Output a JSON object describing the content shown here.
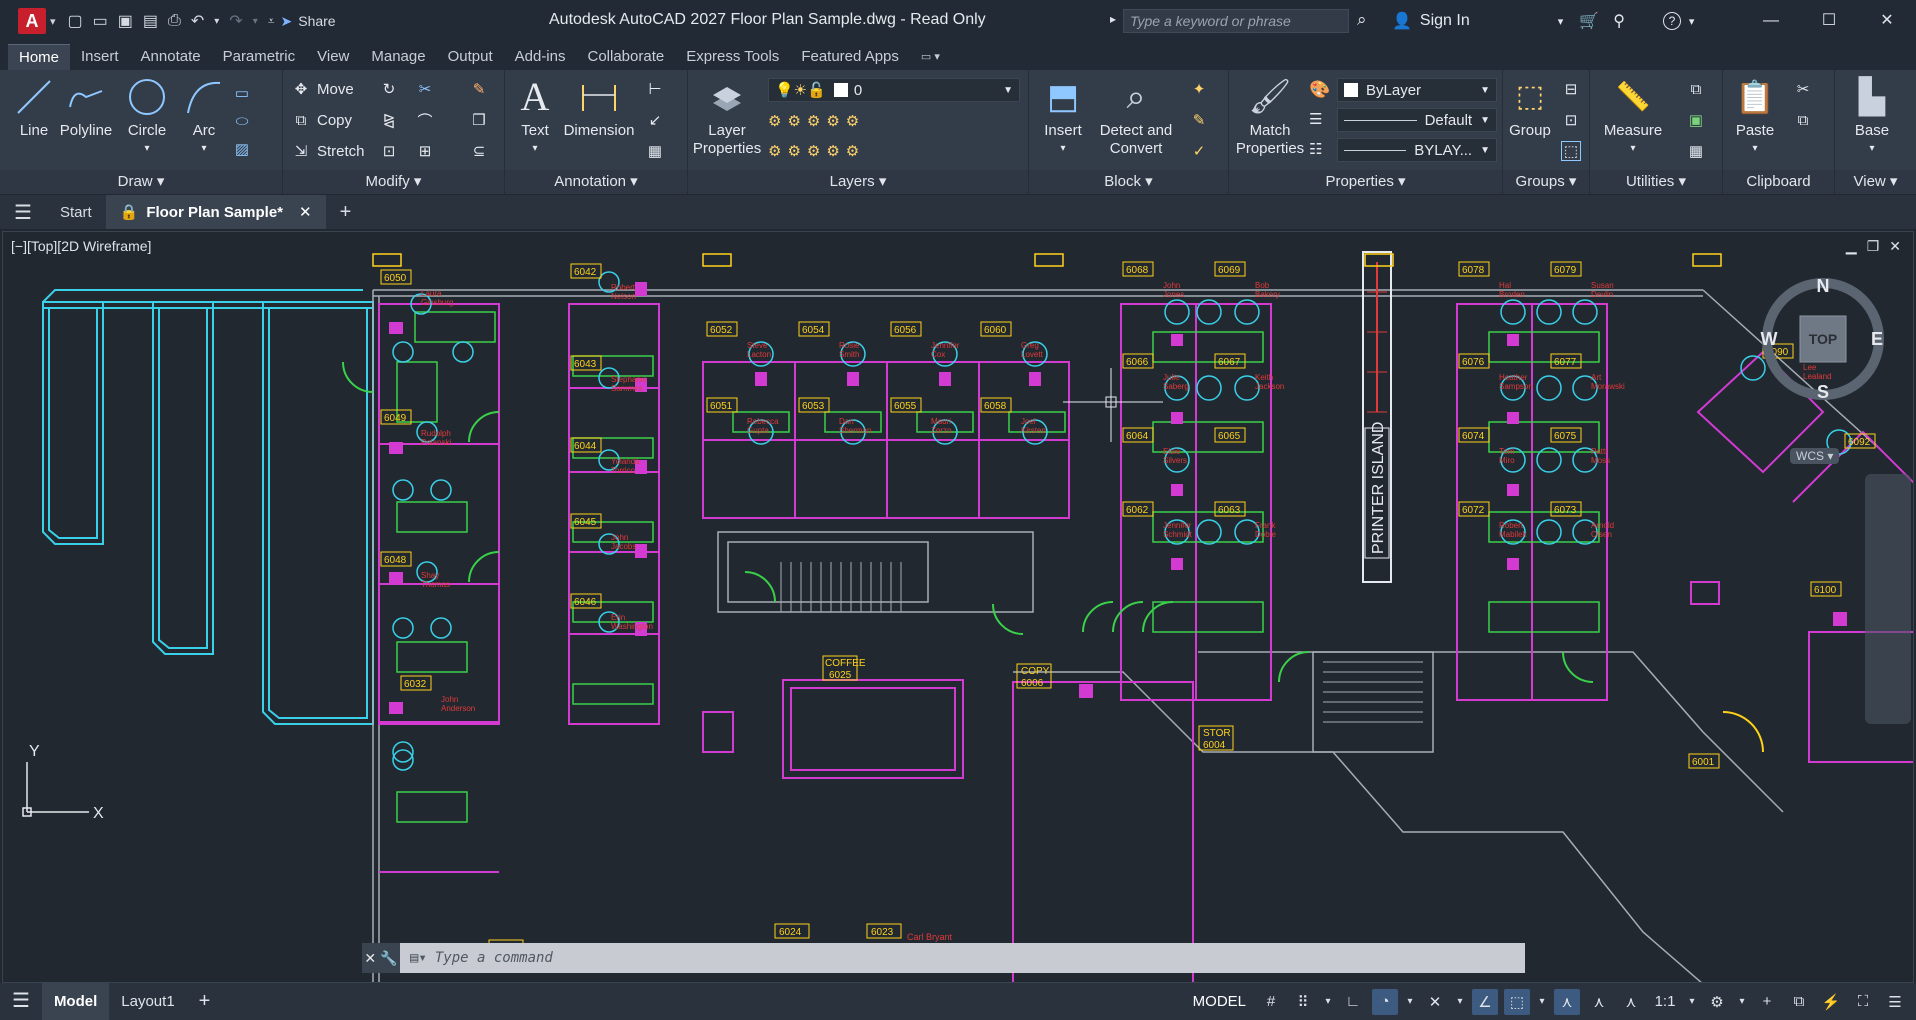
{
  "app": {
    "title": "Autodesk AutoCAD 2027   Floor Plan Sample.dwg - Read Only",
    "share": "Share",
    "search_placeholder": "Type a keyword or phrase",
    "sign_in": "Sign In"
  },
  "ribbon_tabs": [
    "Home",
    "Insert",
    "Annotate",
    "Parametric",
    "View",
    "Manage",
    "Output",
    "Add-ins",
    "Collaborate",
    "Express Tools",
    "Featured Apps"
  ],
  "panels": {
    "draw": {
      "title": "Draw",
      "tools": [
        "Line",
        "Polyline",
        "Circle",
        "Arc"
      ]
    },
    "modify": {
      "title": "Modify",
      "tools": [
        "Move",
        "Copy",
        "Stretch"
      ]
    },
    "annotation": {
      "title": "Annotation",
      "tools": [
        "Text",
        "Dimension"
      ]
    },
    "layers": {
      "title": "Layers",
      "tool": "Layer Properties",
      "current_layer": "0"
    },
    "block": {
      "title": "Block",
      "tools": [
        "Insert",
        "Detect and Convert"
      ]
    },
    "properties": {
      "title": "Properties",
      "tool": "Match Properties",
      "color": "ByLayer",
      "linetype": "Default",
      "lineweight": "BYLAY..."
    },
    "groups": {
      "title": "Groups",
      "tool": "Group"
    },
    "utilities": {
      "title": "Utilities",
      "tool": "Measure"
    },
    "clipboard": {
      "title": "Clipboard",
      "tool": "Paste"
    },
    "view": {
      "title": "View",
      "tool": "Base"
    }
  },
  "doc_tabs": {
    "start": "Start",
    "active": "Floor Plan Sample*"
  },
  "viewport": {
    "label": "[−][Top][2D Wireframe]",
    "viewcube": {
      "top": "TOP",
      "n": "N",
      "s": "S",
      "e": "E",
      "w": "W"
    },
    "wcs": "WCS",
    "ucs_x": "X",
    "ucs_y": "Y"
  },
  "command": {
    "placeholder": "Type a command"
  },
  "status": {
    "model": "MODEL",
    "scale": "1:1",
    "layouts": [
      "Model",
      "Layout1"
    ]
  },
  "rooms": [
    {
      "id": "6050",
      "name": "Laura Ginsburg"
    },
    {
      "id": "6049",
      "name": "Rudolph Polanski"
    },
    {
      "id": "6048",
      "name": "Shay Thomas"
    },
    {
      "id": "6032",
      "name": "John Anderson"
    },
    {
      "id": "6042",
      "name": "Robert Nelson"
    },
    {
      "id": "6043",
      "name": "Stephanie Sammes"
    },
    {
      "id": "6044",
      "name": "Yolanda Torrico"
    },
    {
      "id": "6045",
      "name": "John Jacobs"
    },
    {
      "id": "6046",
      "name": "Erin Washington"
    },
    {
      "id": "6052",
      "name": "Steve Lacton"
    },
    {
      "id": "6054",
      "name": "Rosie Smith"
    },
    {
      "id": "6056",
      "name": "Jennifer Cox"
    },
    {
      "id": "6060",
      "name": "Greg Lovett"
    },
    {
      "id": "6051",
      "name": "Rebecca Gupta"
    },
    {
      "id": "6053",
      "name": "Dan Sherman"
    },
    {
      "id": "6055",
      "name": "Mauri Zorzo"
    },
    {
      "id": "6058",
      "name": "Joel Kirsten"
    },
    {
      "id": "6068",
      "name": "John Jones"
    },
    {
      "id": "6069",
      "name": "Bob Bakery"
    },
    {
      "id": "6066",
      "name": "Julie Saberg"
    },
    {
      "id": "6067",
      "name": "Keith Jackson"
    },
    {
      "id": "6064",
      "name": "Elsie Silvers"
    },
    {
      "id": "6065",
      "name": ""
    },
    {
      "id": "6062",
      "name": "Jennifer Schmidt"
    },
    {
      "id": "6063",
      "name": "Frank Doble"
    },
    {
      "id": "6078",
      "name": "Hal Broden"
    },
    {
      "id": "6079",
      "name": "Susan Devlin"
    },
    {
      "id": "6076",
      "name": "Heather Sampson"
    },
    {
      "id": "6077",
      "name": "Art Morawski"
    },
    {
      "id": "6074",
      "name": "Terri Miro"
    },
    {
      "id": "6075",
      "name": "Patti Moss"
    },
    {
      "id": "6072",
      "name": "Robert Mabilek"
    },
    {
      "id": "6073",
      "name": "Arnold Olsen"
    },
    {
      "id": "6090",
      "name": "Lee Lealand"
    },
    {
      "id": "6092",
      "name": ""
    },
    {
      "id": "6100",
      "name": ""
    },
    {
      "id": "6001",
      "name": ""
    }
  ],
  "labels": {
    "printer_island": "PRINTER ISLAND",
    "coffee": "COFFEE",
    "coffee_id": "6025",
    "copy": "COPY",
    "copy_id": "6006",
    "stor": "STOR",
    "stor_id": "6004",
    "room_6024": "6024",
    "room_6023": "6023",
    "room_6030": "6030",
    "name_6023": "Carl Bryant"
  }
}
